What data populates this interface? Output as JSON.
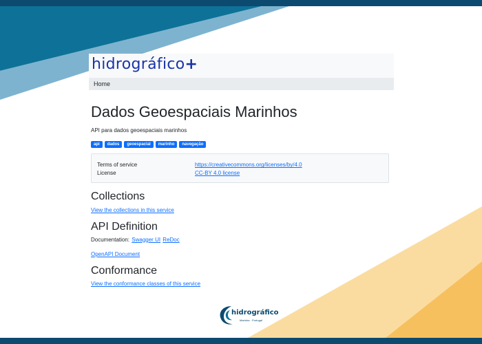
{
  "brand": {
    "name": "hidrográfico",
    "plus": "+"
  },
  "nav": {
    "home": "Home"
  },
  "page": {
    "title": "Dados Geoespaciais Marinhos",
    "subtitle": "API para dados geoespaciais marinhos"
  },
  "tags": [
    "api",
    "dados",
    "geoespacial",
    "marinho",
    "navegação"
  ],
  "info": {
    "terms_label": "Terms of service",
    "terms_link": "https://creativecommons.org/licenses/by/4.0",
    "license_label": "License",
    "license_link": "CC-BY 4.0 license"
  },
  "collections": {
    "title": "Collections",
    "link": "View the collections in this service"
  },
  "api_definition": {
    "title": "API Definition",
    "doc_label": "Documentation:",
    "swagger": "Swagger UI",
    "redoc": "ReDoc",
    "openapi": "OpenAPI Document"
  },
  "conformance": {
    "title": "Conformance",
    "link": "View the conformance classes of this service"
  },
  "footer": {
    "logo_text": "hidrográfico",
    "logo_sub": "Marinha · Portugal"
  },
  "colors": {
    "dark_blue": "#0c4a70",
    "teal": "#0e7298",
    "light_teal": "#7db3cf",
    "orange": "#f7c05f",
    "light_orange": "#fbdca0",
    "brand_blue": "#1a34a8",
    "link_blue": "#0d6efd"
  }
}
